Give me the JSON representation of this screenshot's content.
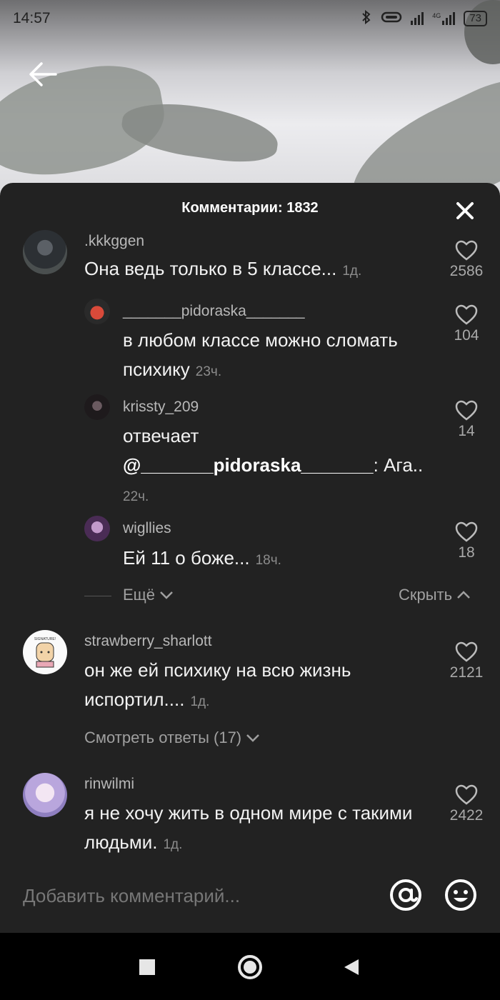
{
  "status_bar": {
    "time": "14:57",
    "network_label": "4G",
    "battery": "73"
  },
  "sheet": {
    "title": "Комментарии: 1832"
  },
  "comments": [
    {
      "username": ".kkkggen",
      "text": "Она ведь только в 5 классе...",
      "time": "1д.",
      "likes": "2586"
    },
    {
      "username": "_______pidoraska_______",
      "text": "в любом классе можно сломать психику",
      "time": "23ч.",
      "likes": "104"
    },
    {
      "username": "krissty_209",
      "text_prefix": "отвечает",
      "mention": "@_______pidoraska_______",
      "text_suffix": ": Ага..",
      "time": "22ч.",
      "likes": "14"
    },
    {
      "username": "wigllies",
      "text": "Ей 11 о боже...",
      "time": "18ч.",
      "likes": "18"
    },
    {
      "username": "strawberry_sharlott",
      "avatar_caption": "SIGNATURE!",
      "text": "он же ей психику на всю жизнь испортил....",
      "time": "1д.",
      "likes": "2121"
    },
    {
      "username": "rinwilmi",
      "text": "я не хочу жить в одном мире с такими людьми.",
      "time": "1д.",
      "likes": "2422"
    }
  ],
  "thread_controls": {
    "more_label": "Ещё",
    "hide_label": "Скрыть",
    "view_replies_label": "Смотреть ответы (17)"
  },
  "input": {
    "placeholder": "Добавить комментарий..."
  },
  "colors": {
    "sheet_bg": "#222222",
    "text_primary": "#f2f2f2",
    "text_secondary": "#b8b8b8",
    "muted": "#8c8c8c"
  },
  "icons": [
    "back-arrow-icon",
    "close-icon",
    "heart-icon",
    "chevron-down-icon",
    "chevron-up-icon",
    "at-icon",
    "emoji-icon",
    "nav-square-icon",
    "nav-circle-icon",
    "nav-back-triangle-icon",
    "bluetooth-icon",
    "signal-icon",
    "battery-icon"
  ]
}
